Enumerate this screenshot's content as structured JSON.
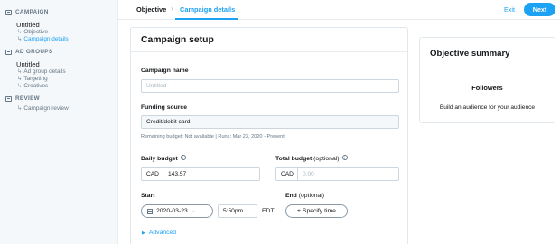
{
  "sidebar": {
    "sections": [
      {
        "title": "CAMPAIGN",
        "name": "Untitled",
        "items": [
          {
            "label": "Objective",
            "active": false
          },
          {
            "label": "Campaign details",
            "active": true
          }
        ]
      },
      {
        "title": "AD GROUPS",
        "name": "Untitled",
        "items": [
          {
            "label": "Ad group details",
            "active": false
          },
          {
            "label": "Targeting",
            "active": false
          },
          {
            "label": "Creatives",
            "active": false
          }
        ]
      },
      {
        "title": "REVIEW",
        "items": [
          {
            "label": "Campaign review",
            "active": false
          }
        ]
      }
    ]
  },
  "topbar": {
    "crumb_objective": "Objective",
    "crumb_separator": "›",
    "crumb_details": "Campaign details",
    "exit": "Exit",
    "next": "Next"
  },
  "setup": {
    "title": "Campaign setup",
    "name_label": "Campaign name",
    "name_placeholder": "Untitled",
    "funding_label": "Funding source",
    "funding_value": "Credit/debit card",
    "funding_hint": "Remaining budget: Not available | Runs: Mar 23, 2020 - Present",
    "daily_label": "Daily budget",
    "daily_currency": "CAD",
    "daily_value": "143.57",
    "total_label": "Total budget",
    "total_optional": "(optional)",
    "total_currency": "CAD",
    "total_placeholder": "0.00",
    "start_label": "Start",
    "start_date": "2020-03-23",
    "start_time": "5:50pm",
    "timezone": "EDT",
    "end_label": "End",
    "end_optional": "(optional)",
    "specify_time": "+ Specify time",
    "advanced": "Advanced",
    "info_glyph": "i"
  },
  "summary": {
    "title": "Objective summary",
    "objective": "Followers",
    "description": "Build an audience for your audience"
  },
  "colors": {
    "accent": "#1da1f2",
    "border": "#e1e8ed",
    "muted": "#657786"
  }
}
